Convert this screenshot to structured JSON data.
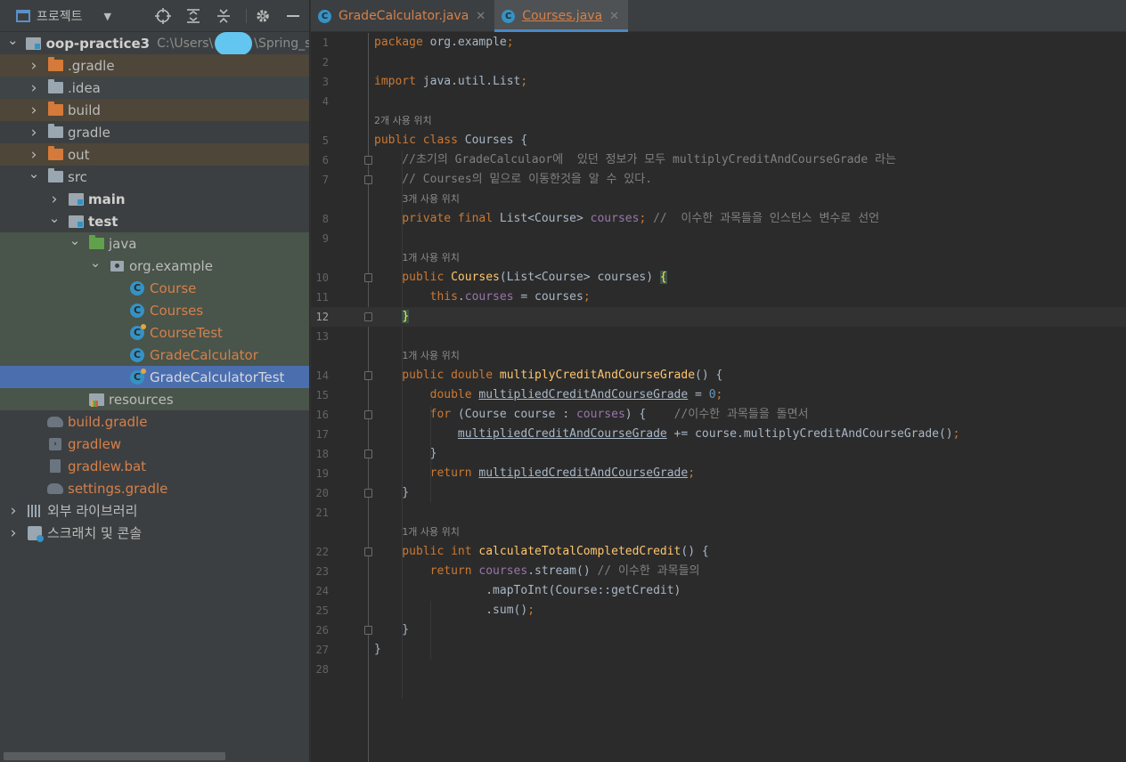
{
  "project_panel": {
    "title": "프로젝트",
    "tree": [
      {
        "name": "oop-practice3",
        "path_prefix": "C:\\Users\\",
        "path_suffix": "\\Spring_stu",
        "depth": 0,
        "expanded": true,
        "type": "module"
      },
      {
        "name": ".gradle",
        "depth": 1,
        "expanded": false,
        "type": "folder-orange"
      },
      {
        "name": ".idea",
        "depth": 1,
        "expanded": false,
        "type": "folder-gray"
      },
      {
        "name": "build",
        "depth": 1,
        "expanded": false,
        "type": "folder-orange"
      },
      {
        "name": "gradle",
        "depth": 1,
        "expanded": false,
        "type": "folder-gray"
      },
      {
        "name": "out",
        "depth": 1,
        "expanded": false,
        "type": "folder-orange"
      },
      {
        "name": "src",
        "depth": 1,
        "expanded": true,
        "type": "folder-gray"
      },
      {
        "name": "main",
        "depth": 2,
        "expanded": false,
        "type": "module-folder"
      },
      {
        "name": "test",
        "depth": 2,
        "expanded": true,
        "type": "module-folder"
      },
      {
        "name": "java",
        "depth": 3,
        "expanded": true,
        "type": "folder-green"
      },
      {
        "name": "org.example",
        "depth": 4,
        "expanded": true,
        "type": "package"
      },
      {
        "name": "Course",
        "depth": 5,
        "type": "class"
      },
      {
        "name": "Courses",
        "depth": 5,
        "type": "class"
      },
      {
        "name": "CourseTest",
        "depth": 5,
        "type": "class-test"
      },
      {
        "name": "GradeCalculator",
        "depth": 5,
        "type": "class"
      },
      {
        "name": "GradeCalculatorTest",
        "depth": 5,
        "type": "class-test",
        "selected": true
      },
      {
        "name": "resources",
        "depth": 3,
        "type": "resources"
      },
      {
        "name": "build.gradle",
        "depth": 1,
        "type": "gradle-file"
      },
      {
        "name": "gradlew",
        "depth": 1,
        "type": "terminal-file"
      },
      {
        "name": "gradlew.bat",
        "depth": 1,
        "type": "bat-file"
      },
      {
        "name": "settings.gradle",
        "depth": 1,
        "type": "gradle-file"
      },
      {
        "name": "외부 라이브러리",
        "depth": 0,
        "expanded": false,
        "type": "libraries"
      },
      {
        "name": "스크래치 및 콘솔",
        "depth": 0,
        "expanded": false,
        "type": "scratches"
      }
    ]
  },
  "editor": {
    "tabs": [
      {
        "label": "GradeCalculator.java",
        "active": false
      },
      {
        "label": "Courses.java",
        "active": true
      }
    ],
    "current_line": 12,
    "lines": [
      {
        "n": "1",
        "tokens": [
          [
            "kw",
            "package "
          ],
          [
            "",
            "org.example"
          ],
          [
            "kw",
            ";"
          ]
        ]
      },
      {
        "n": "2",
        "tokens": []
      },
      {
        "n": "3",
        "tokens": [
          [
            "kw",
            "import "
          ],
          [
            "",
            "java.util.List"
          ],
          [
            "kw",
            ";"
          ]
        ]
      },
      {
        "n": "4",
        "tokens": []
      },
      {
        "hint": "2개 사용 위치",
        "indent": 0
      },
      {
        "n": "5",
        "tokens": [
          [
            "kw",
            "public class "
          ],
          [
            "",
            "Courses {"
          ]
        ]
      },
      {
        "n": "6",
        "fold": true,
        "tokens": [
          [
            "cm",
            "    //초기의 GradeCalculaor에  있던 정보가 모두 multiplyCreditAndCourseGrade 라는"
          ]
        ]
      },
      {
        "n": "7",
        "fold": true,
        "tokens": [
          [
            "cm",
            "    // Courses의 밑으로 이동한것을 알 수 있다."
          ]
        ]
      },
      {
        "hint": "3개 사용 위치",
        "indent": 4
      },
      {
        "n": "8",
        "tokens": [
          [
            "kw",
            "    private final "
          ],
          [
            "",
            "List<Course> "
          ],
          [
            "fld",
            "courses"
          ],
          [
            "kw",
            "; "
          ],
          [
            "cm",
            "//  이수한 과목들을 인스턴스 변수로 선언"
          ]
        ]
      },
      {
        "n": "9",
        "tokens": []
      },
      {
        "hint": "1개 사용 위치",
        "indent": 4
      },
      {
        "n": "10",
        "fold": true,
        "tokens": [
          [
            "kw",
            "    public "
          ],
          [
            "fn",
            "Courses"
          ],
          [
            "",
            "(List<Course> courses) "
          ],
          [
            "brace",
            "{"
          ]
        ]
      },
      {
        "n": "11",
        "tokens": [
          [
            "kw",
            "        this"
          ],
          [
            "",
            "."
          ],
          [
            "fld",
            "courses"
          ],
          [
            "",
            " = courses"
          ],
          [
            "kw",
            ";"
          ]
        ]
      },
      {
        "n": "12",
        "fold": true,
        "tokens": [
          [
            "",
            "    "
          ],
          [
            "brace",
            "}"
          ]
        ]
      },
      {
        "n": "13",
        "tokens": []
      },
      {
        "hint": "1개 사용 위치",
        "indent": 4
      },
      {
        "n": "14",
        "fold": true,
        "tokens": [
          [
            "kw",
            "    public double "
          ],
          [
            "fn",
            "multiplyCreditAndCourseGrade"
          ],
          [
            "",
            "() {"
          ]
        ]
      },
      {
        "n": "15",
        "tokens": [
          [
            "kw",
            "        double "
          ],
          [
            "ul",
            "multipliedCreditAndCourseGrade"
          ],
          [
            "",
            " = "
          ],
          [
            "num",
            "0"
          ],
          [
            "kw",
            ";"
          ]
        ]
      },
      {
        "n": "16",
        "fold": true,
        "tokens": [
          [
            "kw",
            "        for "
          ],
          [
            "",
            "(Course course : "
          ],
          [
            "fld",
            "courses"
          ],
          [
            "",
            ") {    "
          ],
          [
            "cm",
            "//이수한 과목들을 돌면서"
          ]
        ]
      },
      {
        "n": "17",
        "tokens": [
          [
            "",
            "            "
          ],
          [
            "ul",
            "multipliedCreditAndCourseGrade"
          ],
          [
            "",
            " += course.multiplyCreditAndCourseGrade()"
          ],
          [
            "kw",
            ";"
          ]
        ]
      },
      {
        "n": "18",
        "fold": true,
        "tokens": [
          [
            "",
            "        }"
          ]
        ]
      },
      {
        "n": "19",
        "tokens": [
          [
            "kw",
            "        return "
          ],
          [
            "ul",
            "multipliedCreditAndCourseGrade"
          ],
          [
            "kw",
            ";"
          ]
        ]
      },
      {
        "n": "20",
        "fold": true,
        "tokens": [
          [
            "",
            "    }"
          ]
        ]
      },
      {
        "n": "21",
        "tokens": []
      },
      {
        "hint": "1개 사용 위치",
        "indent": 4
      },
      {
        "n": "22",
        "fold": true,
        "tokens": [
          [
            "kw",
            "    public int "
          ],
          [
            "fn",
            "calculateTotalCompletedCredit"
          ],
          [
            "",
            "() {"
          ]
        ]
      },
      {
        "n": "23",
        "tokens": [
          [
            "kw",
            "        return "
          ],
          [
            "fld",
            "courses"
          ],
          [
            "",
            ".stream() "
          ],
          [
            "cm",
            "// 이수한 과목들의"
          ]
        ]
      },
      {
        "n": "24",
        "tokens": [
          [
            "",
            "                .mapToInt(Course::getCredit)"
          ]
        ]
      },
      {
        "n": "25",
        "tokens": [
          [
            "",
            "                .sum()"
          ],
          [
            "kw",
            ";"
          ]
        ]
      },
      {
        "n": "26",
        "fold": true,
        "tokens": [
          [
            "",
            "    }"
          ]
        ]
      },
      {
        "n": "27",
        "tokens": [
          [
            "",
            "}"
          ]
        ]
      },
      {
        "n": "28",
        "tokens": []
      }
    ]
  },
  "colors": {
    "keyword": "#cc7832",
    "field": "#9876aa",
    "method": "#ffc66d",
    "comment": "#808080",
    "number": "#6897bb",
    "selection": "#4b6eaf",
    "modified_file": "#d5804a"
  }
}
